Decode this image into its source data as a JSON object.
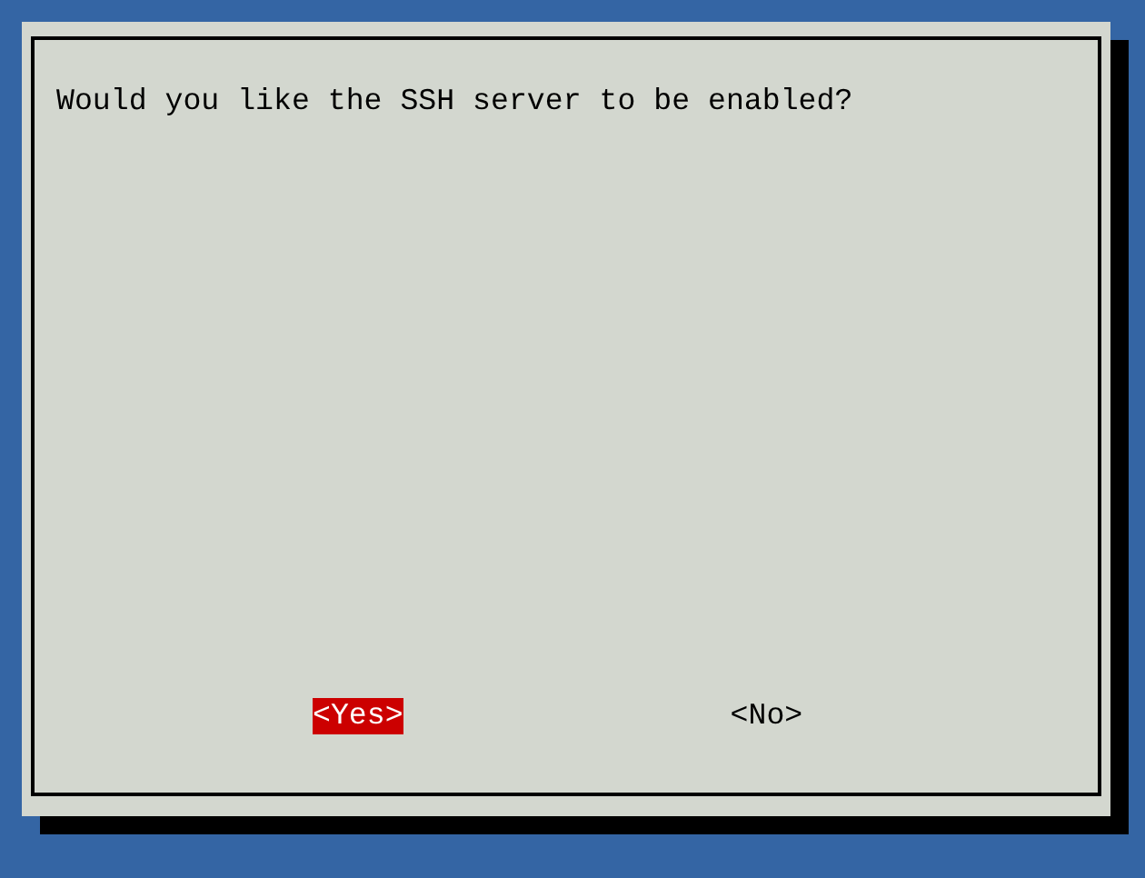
{
  "message": "Would you like the SSH server to be enabled?",
  "buttons": [
    {
      "label": "<Yes>",
      "selected": true
    },
    {
      "label": "<No>",
      "selected": false
    }
  ]
}
